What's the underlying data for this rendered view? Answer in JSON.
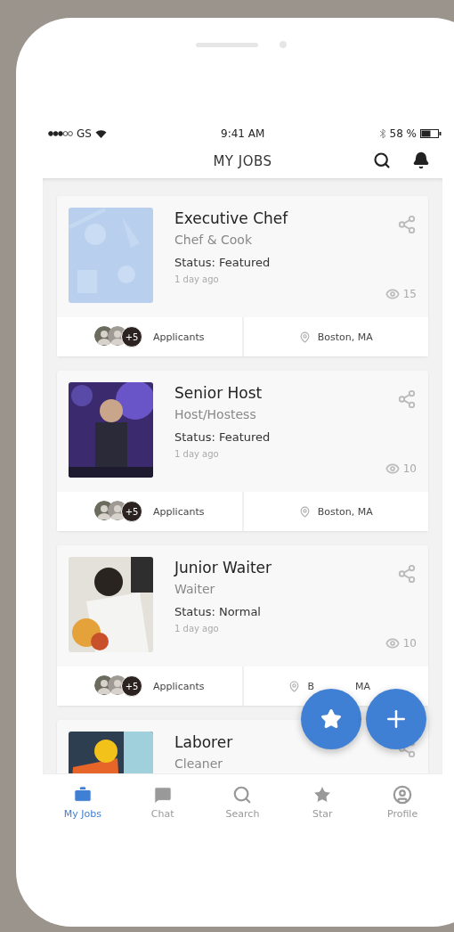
{
  "status_bar": {
    "carrier": "GS",
    "time": "9:41 AM",
    "battery": "58 %"
  },
  "header": {
    "title": "MY JOBS"
  },
  "jobs": [
    {
      "title": "Executive Chef",
      "category": "Chef & Cook",
      "status": "Status: Featured",
      "posted": "1 day ago",
      "views": "15",
      "applicants_extra": "+5",
      "applicants_label": "Applicants",
      "location": "Boston, MA"
    },
    {
      "title": "Senior Host",
      "category": "Host/Hostess",
      "status": "Status: Featured",
      "posted": "1 day ago",
      "views": "10",
      "applicants_extra": "+5",
      "applicants_label": "Applicants",
      "location": "Boston, MA"
    },
    {
      "title": "Junior Waiter",
      "category": "Waiter",
      "status": "Status: Normal",
      "posted": "1 day ago",
      "views": "10",
      "applicants_extra": "+5",
      "applicants_label": "Applicants",
      "location": "B",
      "location_end": "MA"
    },
    {
      "title": "Laborer",
      "category": "Cleaner"
    }
  ],
  "tabs": [
    {
      "label": "My Jobs",
      "selected": true
    },
    {
      "label": "Chat",
      "selected": false
    },
    {
      "label": "Search",
      "selected": false
    },
    {
      "label": "Star",
      "selected": false
    },
    {
      "label": "Profile",
      "selected": false
    }
  ]
}
